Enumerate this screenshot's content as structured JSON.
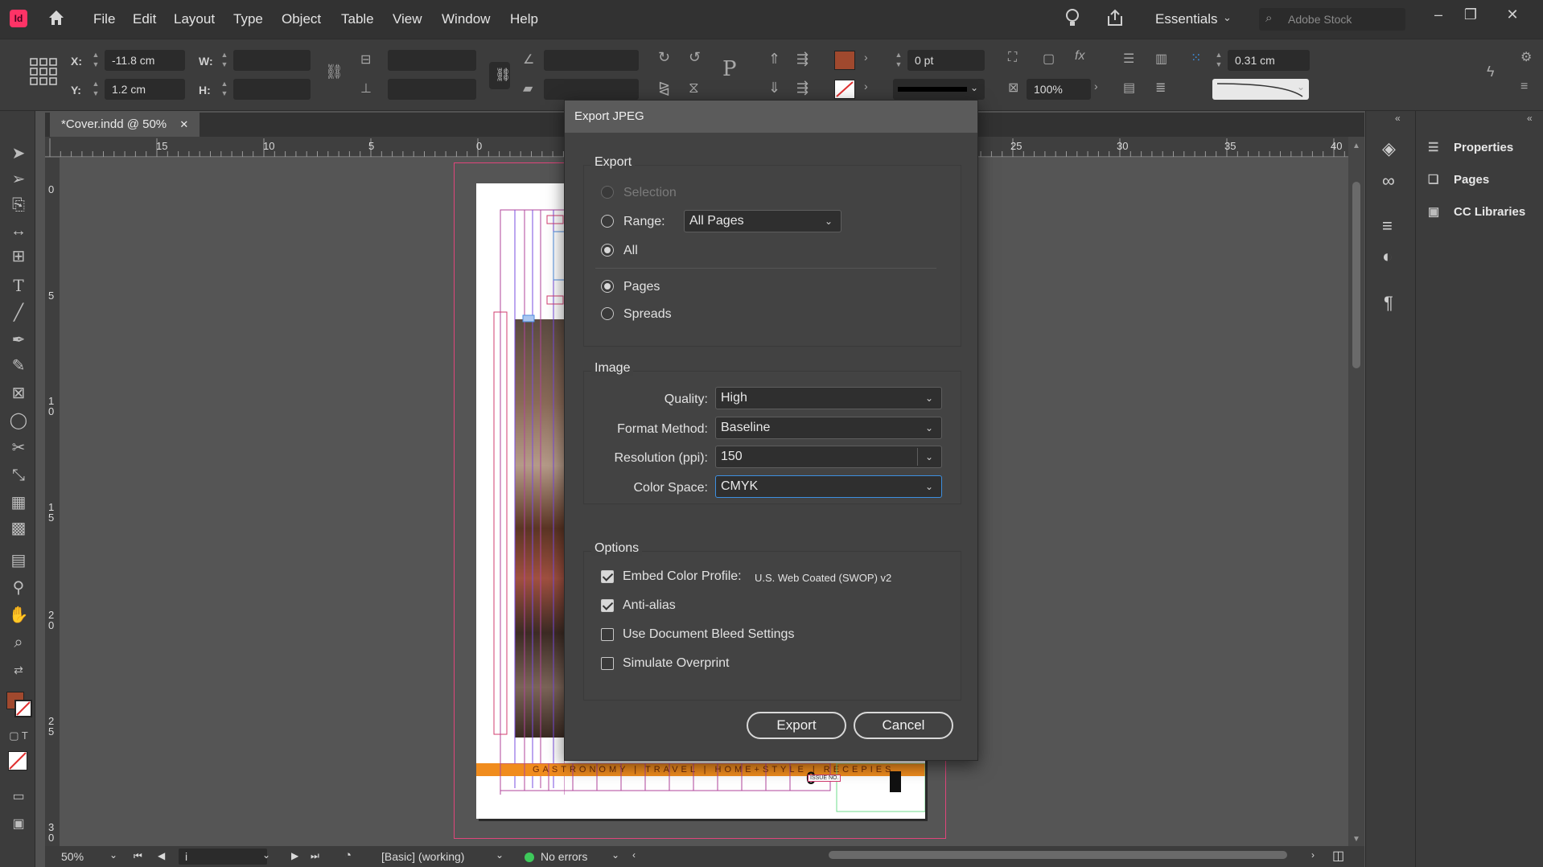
{
  "app": {
    "icon_text": "Id"
  },
  "menu": [
    "File",
    "Edit",
    "Layout",
    "Type",
    "Object",
    "Table",
    "View",
    "Window",
    "Help"
  ],
  "topbar": {
    "workspace": "Essentials",
    "search_placeholder": "Adobe Stock"
  },
  "control": {
    "x_label": "X:",
    "x_value": "-11.8 cm",
    "y_label": "Y:",
    "y_value": "1.2 cm",
    "w_label": "W:",
    "h_label": "H:",
    "stroke_weight": "0 pt",
    "opacity": "100%",
    "gap": "0.31 cm",
    "fill_color": "#a0492e"
  },
  "document": {
    "tab_title": "*Cover.indd @ 50%"
  },
  "ruler": {
    "h_ticks": [
      "15",
      "10",
      "5",
      "0",
      "25",
      "30",
      "35",
      "40"
    ],
    "v_ticks": [
      "0",
      "5",
      "1 0",
      "1 5",
      "2 0",
      "2 5",
      "3 0"
    ]
  },
  "cover": {
    "nav_strip": "GASTRONOMY | TRAVEL | HOME+STYLE | RECEPIES",
    "issue": "ISSUE NO."
  },
  "status": {
    "zoom": "50%",
    "page": "i",
    "style": "[Basic] (working)",
    "errors": "No errors"
  },
  "panels": [
    {
      "icon": "sliders-icon",
      "label": "Properties"
    },
    {
      "icon": "pages-icon",
      "label": "Pages"
    },
    {
      "icon": "cc-libraries-icon",
      "label": "CC Libraries"
    }
  ],
  "dialog": {
    "title": "Export JPEG",
    "export_group": "Export",
    "selection_label": "Selection",
    "range_label": "Range:",
    "range_value": "All Pages",
    "all_label": "All",
    "pages_label": "Pages",
    "spreads_label": "Spreads",
    "image_group": "Image",
    "quality_label": "Quality:",
    "quality_value": "High",
    "format_label": "Format Method:",
    "format_value": "Baseline",
    "resolution_label": "Resolution (ppi):",
    "resolution_value": "150",
    "colorspace_label": "Color Space:",
    "colorspace_value": "CMYK",
    "options_group": "Options",
    "embed_label": "Embed Color Profile:",
    "embed_profile": "U.S. Web Coated (SWOP) v2",
    "antialias_label": "Anti-alias",
    "bleed_label": "Use Document Bleed Settings",
    "overprint_label": "Simulate Overprint",
    "export_button": "Export",
    "cancel_button": "Cancel"
  }
}
